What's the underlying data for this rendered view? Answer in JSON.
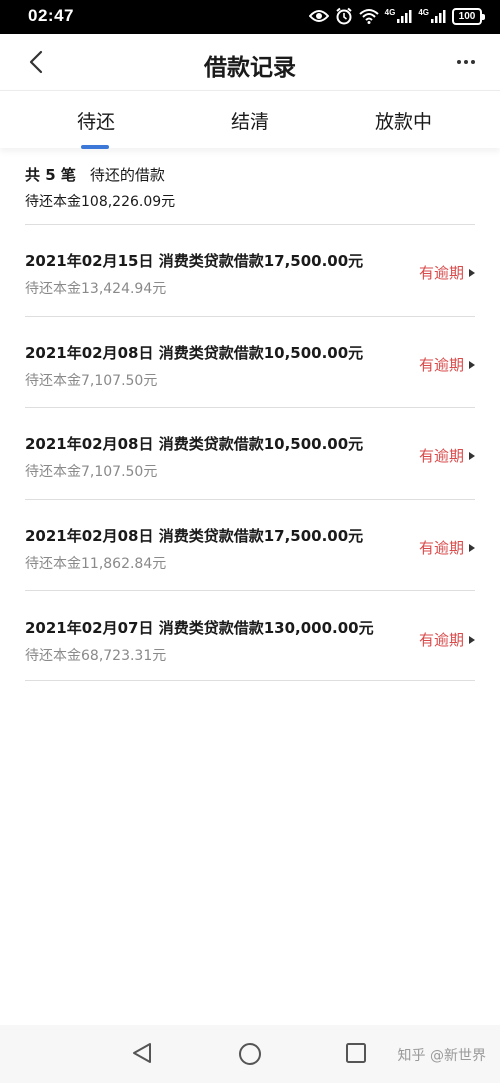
{
  "status_bar": {
    "time": "02:47",
    "network_1": "4G",
    "network_2": "4G",
    "battery": "100",
    "icons": [
      "eye-icon",
      "alarm-icon",
      "wifi-icon",
      "signal-icon",
      "signal-icon",
      "battery-icon"
    ]
  },
  "header": {
    "title": "借款记录",
    "back_icon": "back-chevron-icon",
    "more_icon": "more-icon"
  },
  "tabs": [
    {
      "label": "待还",
      "active": true
    },
    {
      "label": "结清",
      "active": false
    },
    {
      "label": "放款中",
      "active": false
    }
  ],
  "summary": {
    "count_label": "共 5 笔",
    "type_label": "待还的借款",
    "principal": "待还本金108,226.09元"
  },
  "loans": [
    {
      "title": "2021年02月15日 消费类贷款借款17,500.00元",
      "remaining": "待还本金13,424.94元",
      "status": "有逾期"
    },
    {
      "title": "2021年02月08日 消费类贷款借款10,500.00元",
      "remaining": "待还本金7,107.50元",
      "status": "有逾期"
    },
    {
      "title": "2021年02月08日 消费类贷款借款10,500.00元",
      "remaining": "待还本金7,107.50元",
      "status": "有逾期"
    },
    {
      "title": "2021年02月08日 消费类贷款借款17,500.00元",
      "remaining": "待还本金11,862.84元",
      "status": "有逾期"
    },
    {
      "title": "2021年02月07日 消费类贷款借款130,000.00元",
      "remaining": "待还本金68,723.31元",
      "status": "有逾期"
    }
  ],
  "system_nav": {
    "icons": [
      "triangle-back-icon",
      "circle-home-icon",
      "square-recents-icon"
    ],
    "watermark": "知乎 @新世界"
  },
  "colors": {
    "accent": "#3c78d8",
    "overdue": "#d94a4a",
    "muted_text": "#8a8a8a"
  }
}
